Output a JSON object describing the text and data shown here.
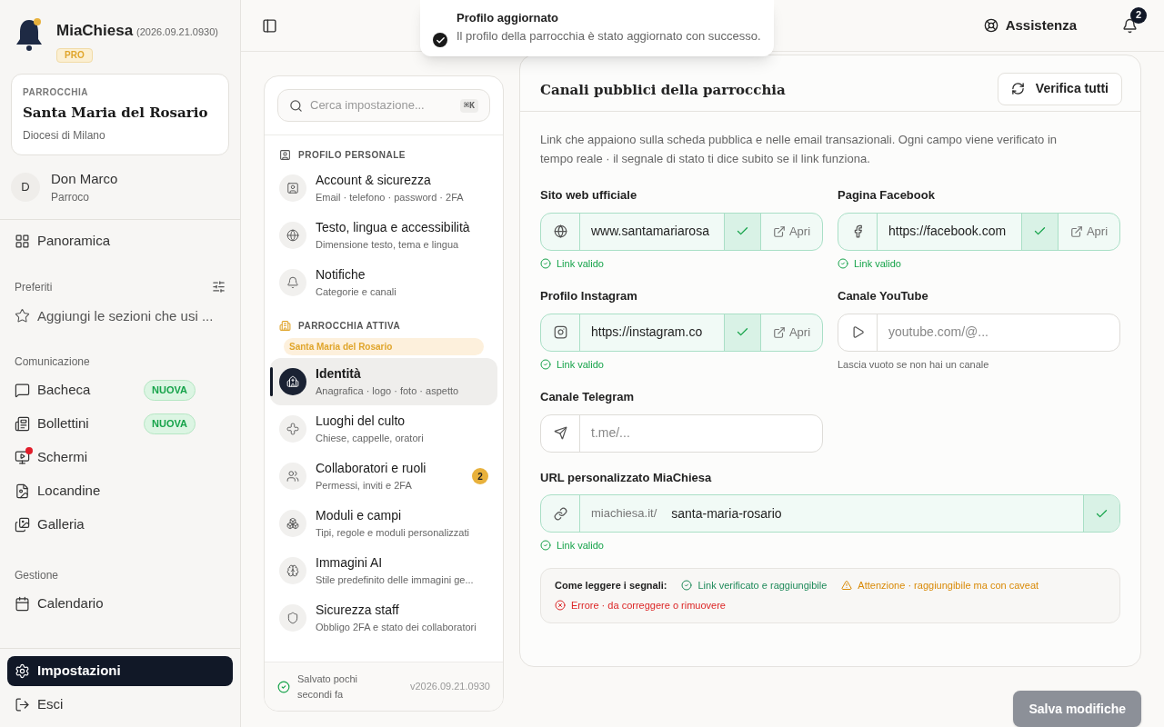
{
  "app": {
    "name": "MiaChiesa",
    "version": "(2026.09.21.0930)",
    "plan": "PRO"
  },
  "parish_card": {
    "label": "PARROCCHIA",
    "name": "Santa Maria del Rosario",
    "diocese": "Diocesi di Milano"
  },
  "user": {
    "initial": "D",
    "name": "Don Marco",
    "role": "Parroco"
  },
  "sidebar": {
    "overview": {
      "label": "Panoramica",
      "selected": false
    },
    "favorites": {
      "title": "Preferiti",
      "hint": "Aggiungi le sezioni che usi ..."
    },
    "sections": [
      {
        "title": "Comunicazione",
        "items": [
          {
            "label": "Bacheca",
            "badge": "NUOVA",
            "alert": false,
            "selected": false
          },
          {
            "label": "Bollettini",
            "badge": "NUOVA",
            "alert": false,
            "selected": false
          },
          {
            "label": "Schermi",
            "alert": true,
            "selected": false
          },
          {
            "label": "Locandine",
            "alert": false,
            "selected": false
          },
          {
            "label": "Galleria",
            "alert": false,
            "selected": false
          }
        ]
      },
      {
        "title": "Gestione",
        "items": [
          {
            "label": "Calendario",
            "alert": false,
            "selected": false
          }
        ]
      }
    ],
    "bottom": [
      {
        "label": "Impostazioni",
        "selected": true
      },
      {
        "label": "Esci",
        "selected": false
      }
    ]
  },
  "topbar": {
    "help": "Assistenza",
    "notifications": "2"
  },
  "toast": {
    "title": "Profilo aggiornato",
    "message": "Il profilo della parrocchia è stato aggiornato con successo."
  },
  "settings_nav": {
    "search": {
      "placeholder": "Cerca impostazione...",
      "shortcut": "⌘K"
    },
    "groups": [
      {
        "title": "PROFILO PERSONALE",
        "items": [
          {
            "title": "Account & sicurezza",
            "subtitle": "Email · telefono · password · 2FA",
            "selected": false
          },
          {
            "title": "Testo, lingua e accessibilità",
            "subtitle": "Dimensione testo, tema e lingua",
            "selected": false
          },
          {
            "title": "Notifiche",
            "subtitle": "Categorie e canali",
            "selected": false
          }
        ]
      },
      {
        "title": "PARROCCHIA ATTIVA",
        "parish": "Santa Maria del Rosario",
        "items": [
          {
            "title": "Identità",
            "subtitle": "Anagrafica · logo · foto · aspetto",
            "selected": true
          },
          {
            "title": "Luoghi del culto",
            "subtitle": "Chiese, cappelle, oratori",
            "selected": false
          },
          {
            "title": "Collaboratori e ruoli",
            "subtitle": "Permessi, inviti e 2FA",
            "selected": false,
            "count": "2"
          },
          {
            "title": "Moduli e campi",
            "subtitle": "Tipi, regole e moduli personalizzati",
            "selected": false
          },
          {
            "title": "Immagini AI",
            "subtitle": "Stile predefinito delle immagini ge...",
            "selected": false
          },
          {
            "title": "Sicurezza staff",
            "subtitle": "Obbligo 2FA e stato dei collaboratori",
            "selected": false
          }
        ]
      }
    ],
    "footer": {
      "status": "Salvato pochi secondi fa",
      "version": "v2026.09.21.0930"
    }
  },
  "card": {
    "title": "Canali pubblici della parrocchia",
    "verify_button": "Verifica tutti",
    "description": "Link che appaiono sulla scheda pubblica e nelle email transazionali. Ogni campo viene verificato in tempo reale · il segnale di stato ti dice subito se il link funziona.",
    "fields": [
      {
        "label": "Sito web ufficiale",
        "value": "www.santamariarosa",
        "valid": true,
        "status_text": "Link valido",
        "open": "Apri"
      },
      {
        "label": "Pagina Facebook",
        "value": "https://facebook.com",
        "valid": true,
        "status_text": "Link valido",
        "open": "Apri"
      },
      {
        "label": "Profilo Instagram",
        "value": "https://instagram.co",
        "valid": true,
        "status_text": "Link valido",
        "open": "Apri"
      },
      {
        "label": "Canale YouTube",
        "placeholder": "youtube.com/@...",
        "valid": false,
        "hint": "Lascia vuoto se non hai un canale"
      },
      {
        "label": "Canale Telegram",
        "placeholder": "t.me/...",
        "valid": false
      },
      {
        "label": "URL personalizzato MiaChiesa",
        "prefix": "miachiesa.it/",
        "value": "santa-maria-rosario",
        "valid": true,
        "status_text": "Link valido"
      }
    ],
    "legend": {
      "title": "Come leggere i segnali:",
      "items": [
        {
          "kind": "valid",
          "text": "Link verificato e raggiungibile"
        },
        {
          "kind": "warning",
          "text": "Attenzione · raggiungibile ma con caveat"
        },
        {
          "kind": "error",
          "text": "Errore · da correggere o rimuovere"
        }
      ]
    }
  },
  "save": {
    "label": "Salva modifiche",
    "disabled": true
  }
}
